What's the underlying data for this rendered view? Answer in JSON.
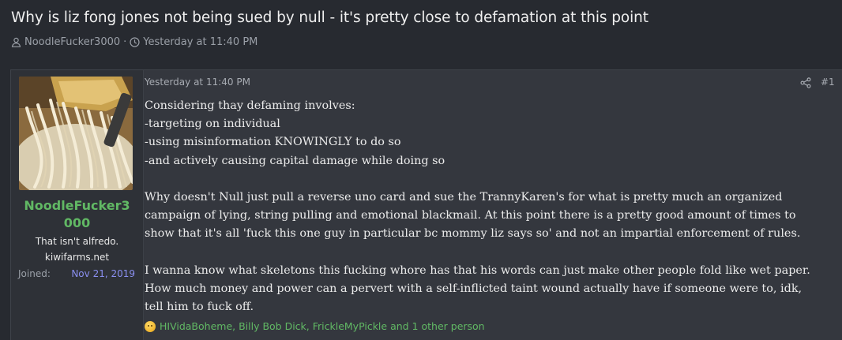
{
  "thread": {
    "title": "Why is liz fong jones not being sued by null - it's pretty close to defamation at this point",
    "author": "NoodleFucker3000",
    "separator": "·",
    "date": "Yesterday at 11:40 PM"
  },
  "post": {
    "user": {
      "name_line1": "NoodleFucker3",
      "name_line2": "000",
      "title": "That isn't alfredo.",
      "banner": "kiwifarms.net",
      "joined_label": "Joined:",
      "joined_value": "Nov 21, 2019"
    },
    "date": "Yesterday at 11:40 PM",
    "number": "#1",
    "paragraphs": [
      "Considering thay defaming involves:\n-targeting on individual\n-using misinformation KNOWINGLY to do so\n-and actively causing capital damage while doing so",
      "Why doesn't Null just pull a reverse uno card and sue the TrannyKaren's for what is pretty much an organized\ncampaign of lying, string pulling and emotional blackmail. At this point there is a pretty good amount of times to\nshow that it's all 'fuck this one guy in particular bc mommy liz says so' and not an impartial enforcement of rules.",
      "I wanna know what skeletons this fucking whore has that his words can just make other people fold like wet paper.\nHow much money and power can a pervert with a self-inflicted taint wound actually have if someone were to, idk,\ntell him to fuck off."
    ],
    "reactions": "HIVidaBoheme, Billy Bob Dick, FrickleMyPickle and 1 other person"
  },
  "icons": {
    "author": "user-icon",
    "date": "clock-icon",
    "share": "share-icon",
    "reaction": "thinking-emoji-icon",
    "avatar": "pasta-avatar-image"
  },
  "colors": {
    "username": "#61b864",
    "joined_value": "#8a8ff0",
    "page_background": "#272a30",
    "post_background": "#34373e"
  }
}
